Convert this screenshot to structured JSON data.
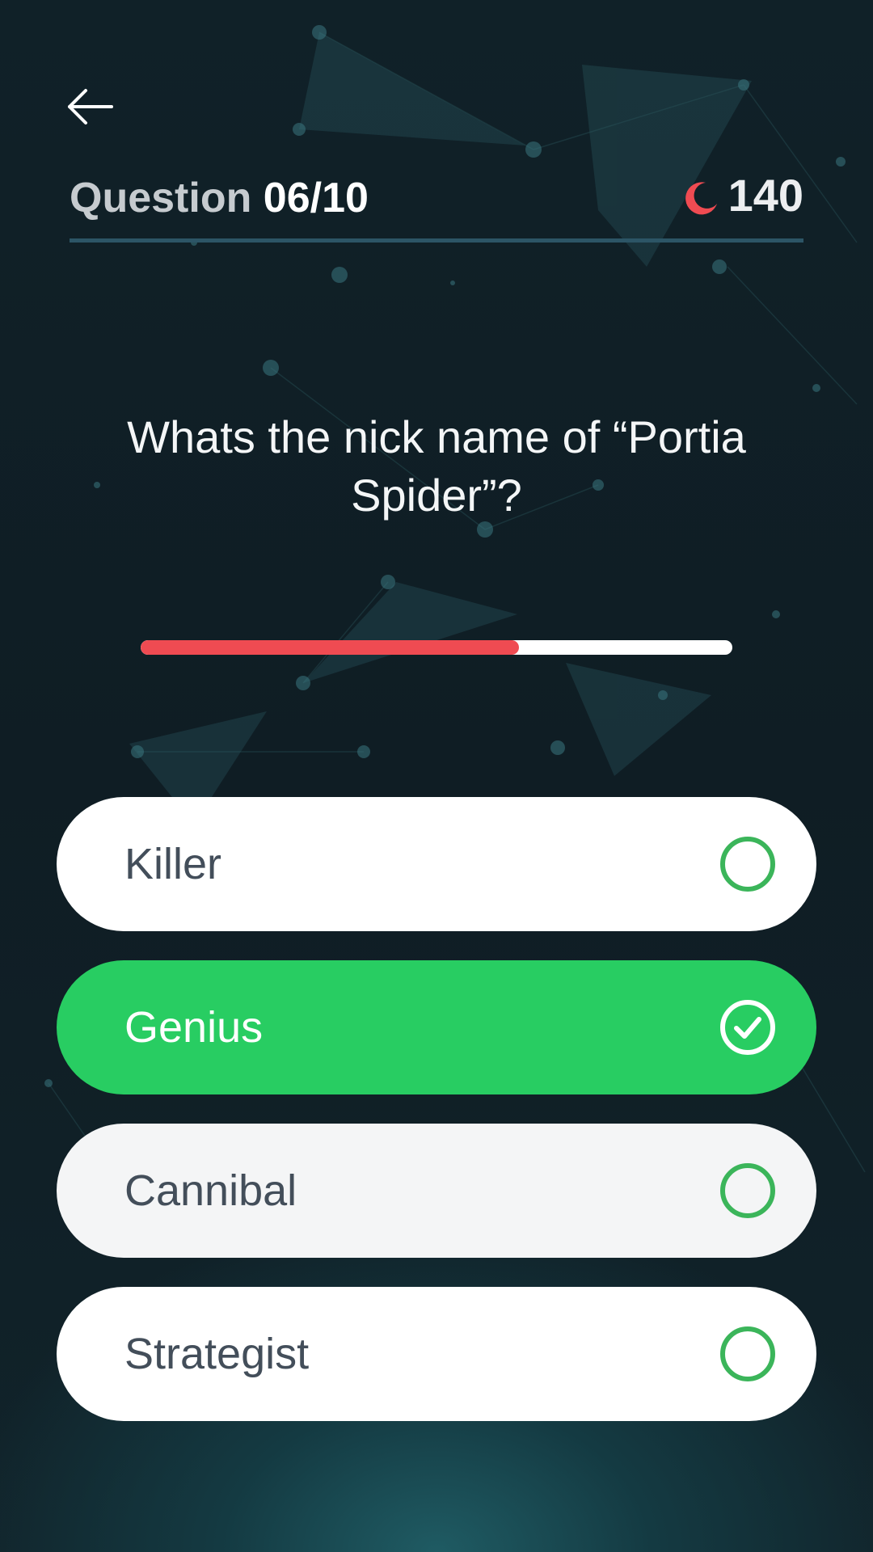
{
  "header": {
    "question_prefix": "Question",
    "question_counter": "06/10",
    "score": "140"
  },
  "question": {
    "text": "Whats the nick name of “Portia Spider”?"
  },
  "timer": {
    "progress": 0.64,
    "fill_color": "#ef4b52",
    "track_color": "#ffffff"
  },
  "options": [
    {
      "label": "Killer",
      "state": "unselected"
    },
    {
      "label": "Genius",
      "state": "selected"
    },
    {
      "label": "Cannibal",
      "state": "unselected"
    },
    {
      "label": "Strategist",
      "state": "unselected"
    }
  ],
  "colors": {
    "accent_green": "#28cd62",
    "accent_red": "#ef4b52",
    "background": "#0f1d24"
  },
  "icons": {
    "back": "back-arrow-icon",
    "score": "moon-icon",
    "option_unselected": "radio-unchecked-icon",
    "option_selected": "check-circle-icon"
  }
}
